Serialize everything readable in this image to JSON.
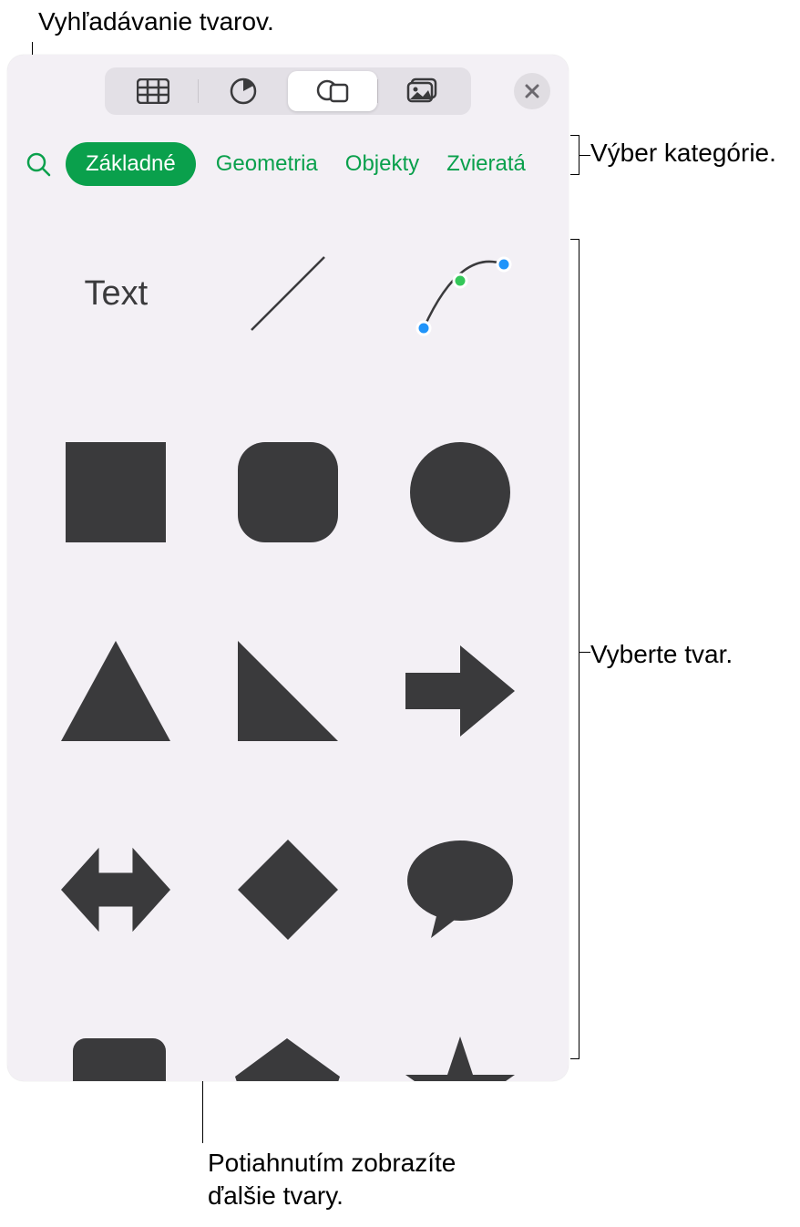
{
  "callouts": {
    "search": "Vyhľadávanie tvarov.",
    "category": "Výber kategórie.",
    "select_shape": "Vyberte tvar.",
    "scroll_more_line1": "Potiahnutím zobrazíte",
    "scroll_more_line2": "ďalšie tvary."
  },
  "top_tabs": {
    "items": [
      "tables",
      "charts",
      "shapes",
      "media"
    ],
    "active_index": 2
  },
  "categories": {
    "items": [
      {
        "label": "Základné",
        "active": true
      },
      {
        "label": "Geometria",
        "active": false
      },
      {
        "label": "Objekty",
        "active": false
      },
      {
        "label": "Zvieratá",
        "active": false
      }
    ]
  },
  "shapes": {
    "text_label": "Text",
    "items": [
      "text",
      "line",
      "curve",
      "square",
      "rounded-square",
      "circle",
      "triangle",
      "right-triangle",
      "arrow-right",
      "arrow-bidirectional",
      "diamond",
      "speech-bubble-round",
      "speech-bubble-square",
      "pentagon",
      "star"
    ]
  },
  "colors": {
    "accent": "#0aa04c",
    "shape_fill": "#3a3a3c"
  }
}
